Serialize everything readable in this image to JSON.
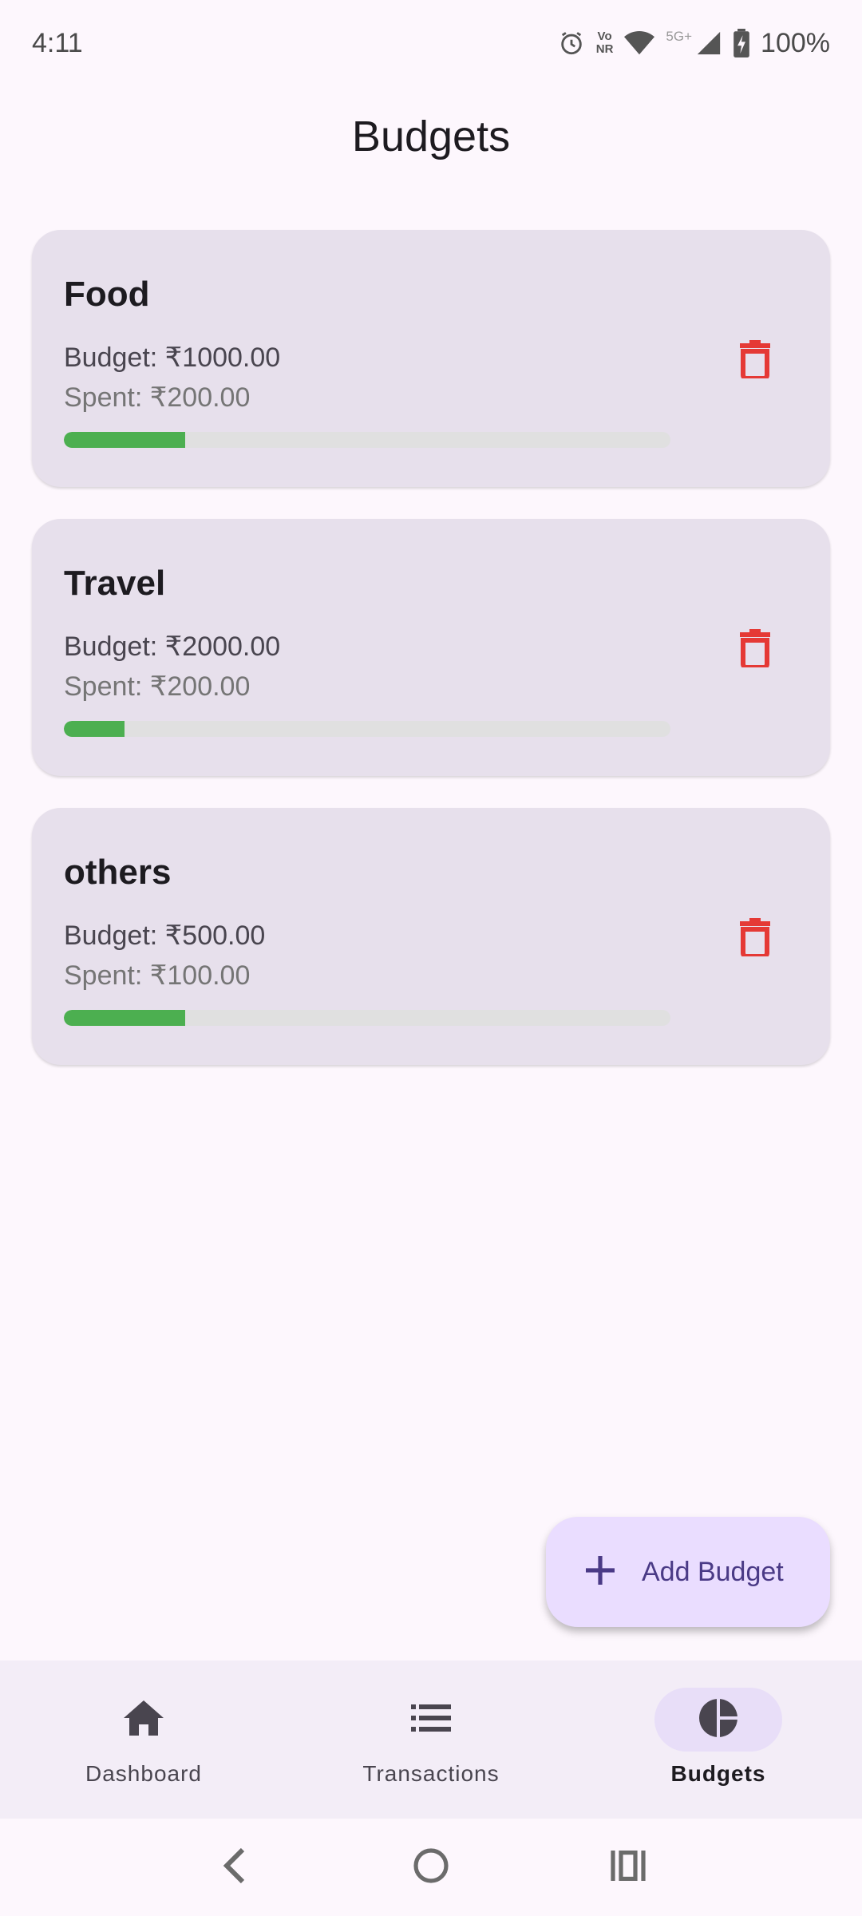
{
  "status_bar": {
    "time": "4:11",
    "network_label": "5G+",
    "volte_top": "Vo",
    "volte_bottom": "NR",
    "battery": "100%"
  },
  "header": {
    "title": "Budgets"
  },
  "budgets": [
    {
      "name": "Food",
      "budget_label": "Budget: ₹1000.00",
      "spent_label": "Spent: ₹200.00",
      "progress": 0.2
    },
    {
      "name": "Travel",
      "budget_label": "Budget: ₹2000.00",
      "spent_label": "Spent: ₹200.00",
      "progress": 0.1
    },
    {
      "name": "others",
      "budget_label": "Budget: ₹500.00",
      "spent_label": "Spent: ₹100.00",
      "progress": 0.2
    }
  ],
  "fab": {
    "label": "Add Budget",
    "icon": "plus-icon"
  },
  "bottom_nav": {
    "items": [
      {
        "label": "Dashboard",
        "icon": "home-icon",
        "active": false
      },
      {
        "label": "Transactions",
        "icon": "list-icon",
        "active": false
      },
      {
        "label": "Budgets",
        "icon": "pie-chart-icon",
        "active": true
      }
    ]
  },
  "colors": {
    "progress": "#4caf50",
    "delete": "#e53935",
    "card": "#e7e0ec",
    "fab": "#eaddff",
    "nav_active": "#e8def8"
  }
}
